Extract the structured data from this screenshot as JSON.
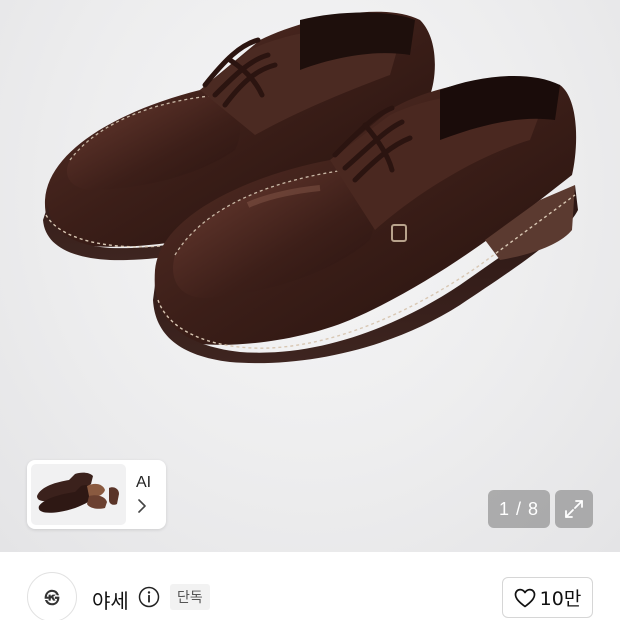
{
  "gallery": {
    "current_page": 1,
    "total_pages": 8,
    "counter_text": "1 / 8",
    "expand_icon": "expand-icon"
  },
  "ai_card": {
    "label": "AI",
    "chevron_icon": "chevron-right-icon"
  },
  "seller": {
    "avatar_text": "㉿",
    "name": "야세",
    "info_icon": "info-icon",
    "badge": "단독"
  },
  "like": {
    "icon": "heart-icon",
    "count": "10만"
  },
  "colors": {
    "leather": "#3a1f1a",
    "suede": "#4a2a22",
    "background": "#ececed",
    "overlay": "#787878"
  }
}
